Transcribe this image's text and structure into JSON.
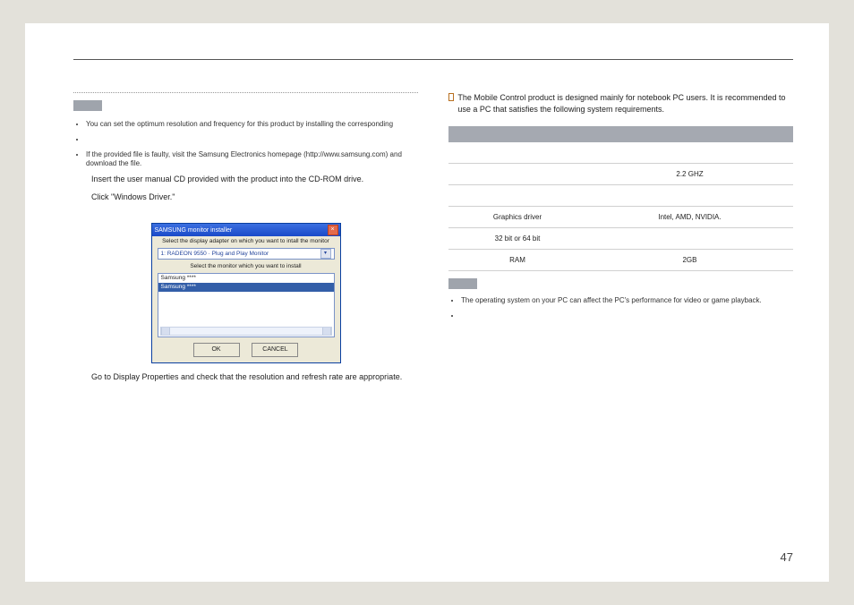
{
  "page_number": "47",
  "left": {
    "bullet1": "You can set the optimum resolution and frequency for this product by installing the corresponding",
    "bullet2": "",
    "bullet3": "If the provided file is faulty, visit the Samsung Electronics homepage (http://www.samsung.com) and download the file.",
    "step1": "Insert the user manual CD provided with the product into the CD-ROM drive.",
    "step2": "Click \"Windows Driver.\"",
    "caption": "Go to Display Properties and check that the resolution and refresh rate are appropriate."
  },
  "installer": {
    "title": "SAMSUNG monitor installer",
    "line1": "Select the display adapter on which you want to intall the monitor",
    "combo": "1: RADEON 9550 · Plug and Play Monitor",
    "line2": "Select the monitor which you want to install",
    "list_item1": "Samsung ****",
    "list_item2": "Samsung ****",
    "ok": "OK",
    "cancel": "CANCEL"
  },
  "right": {
    "intro": "The Mobile Control product is designed mainly for notebook PC users. It is recommended to use a PC that satisfies the following system requirements.",
    "table": {
      "rows": [
        {
          "label": "",
          "value": ""
        },
        {
          "label": "",
          "value": "2.2 GHZ"
        },
        {
          "label": "",
          "value": ""
        },
        {
          "label": "Graphics driver",
          "value": "Intel, AMD, NVIDIA."
        },
        {
          "label": "32 bit or 64 bit",
          "value": ""
        },
        {
          "label": "RAM",
          "value": "2GB"
        }
      ]
    },
    "note1": "The operating system on your PC can affect the PC's performance for video or game playback.",
    "note2": ""
  }
}
